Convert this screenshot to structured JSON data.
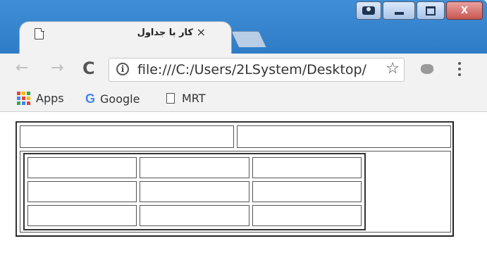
{
  "window": {
    "controls": [
      "profile",
      "minimize",
      "maximize",
      "close"
    ]
  },
  "tab": {
    "title": "کار با جداول",
    "close_glyph": "×",
    "icon": "page-icon"
  },
  "toolbar": {
    "back_glyph": "←",
    "forward_glyph": "→",
    "reload_glyph": "C",
    "info_glyph": "i",
    "url": "file:///C:/Users/2LSystem/Desktop/",
    "star_glyph": "☆",
    "extension_icon": "extension-icon",
    "menu_icon": "menu-dots-icon"
  },
  "bookmarks": {
    "items": [
      {
        "label": "Apps",
        "icon": "apps-grid-icon"
      },
      {
        "label": "Google",
        "icon": "google-g-icon",
        "icon_glyph": "G"
      },
      {
        "label": "MRT",
        "icon": "page-icon"
      }
    ]
  },
  "colors": {
    "titlebar": "#2f7cc7",
    "toolbar": "#f2f2f2",
    "table_border": "#333333",
    "apps_grid": [
      "#ea4335",
      "#fbbc05",
      "#34a853",
      "#4285f4",
      "#ea4335",
      "#fbbc05",
      "#34a853",
      "#4285f4",
      "#ea4335"
    ]
  },
  "page": {
    "outer_table": {
      "rows": 2,
      "first_row_cells": 2
    },
    "inner_table": {
      "rows": 3,
      "cols": 3
    }
  }
}
